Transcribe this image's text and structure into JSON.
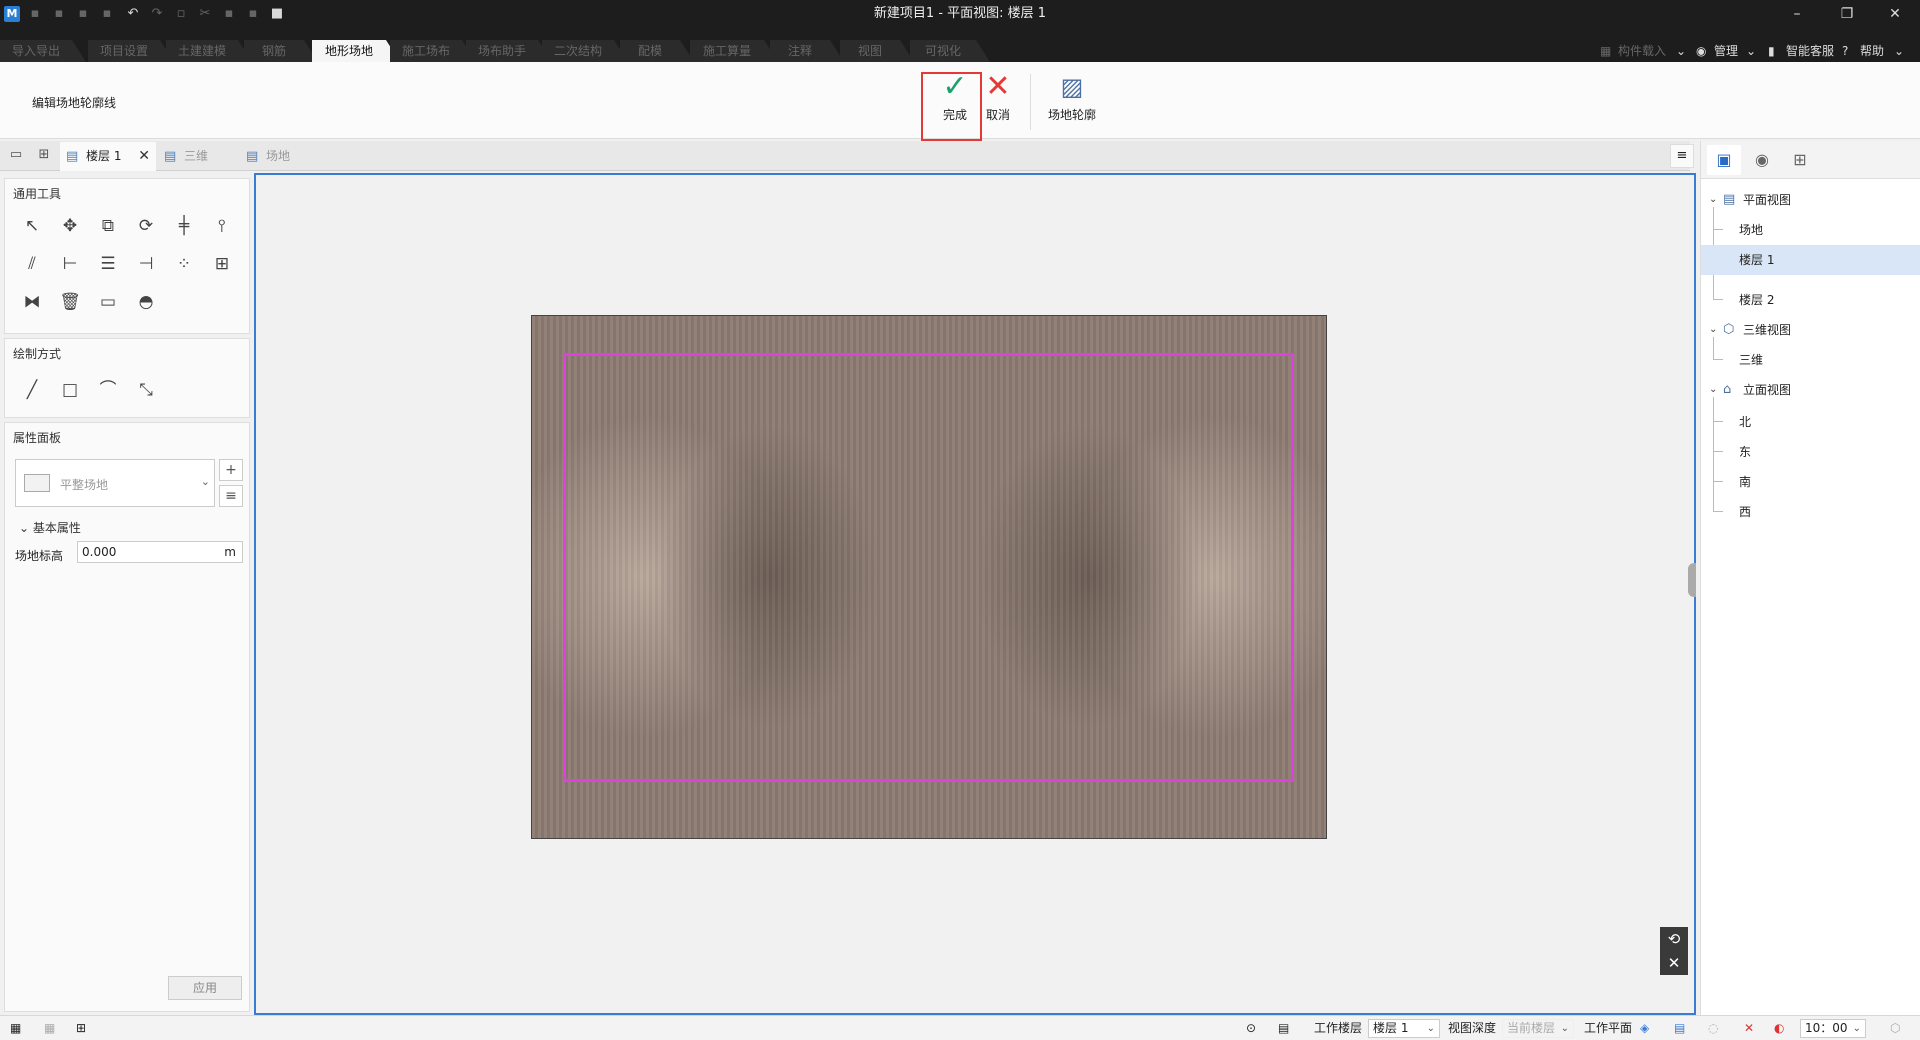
{
  "titlebar": {
    "title": "新建项目1 - 平面视图: 楼层 1",
    "app_icon": "M"
  },
  "ribbon_tabs": [
    "导入导出",
    "项目设置",
    "土建建模",
    "钢筋",
    "地形场地",
    "施工场布",
    "场布助手",
    "二次结构",
    "配模",
    "施工算量",
    "注释",
    "视图",
    "可视化"
  ],
  "active_tab": "地形场地",
  "topbar_right": {
    "component_load": "构件载入",
    "manage": "管理",
    "service": "智能客服",
    "help": "帮助"
  },
  "ribbon": {
    "mode_label": "编辑场地轮廓线",
    "finish": "完成",
    "cancel": "取消",
    "site_outline": "场地轮廓",
    "accent_green": "#1aa36b",
    "accent_red": "#e53935"
  },
  "view_tabs": {
    "floor1": "楼层 1",
    "three_d": "三维",
    "site": "场地"
  },
  "left_panel": {
    "general_tools": "通用工具",
    "draw_mode": "绘制方式",
    "props_panel": "属性面板",
    "type_placeholder": "平整场地",
    "basic_props": "基本属性",
    "site_elevation_label": "场地标高",
    "site_elevation_value": "0.000",
    "unit": "m",
    "apply": "应用"
  },
  "tree": {
    "plan_views": "平面视图",
    "site": "场地",
    "floor1": "楼层 1",
    "floor2": "楼层 2",
    "three_d_views": "三维视图",
    "three_d": "三维",
    "elevation_views": "立面视图",
    "north": "北",
    "east": "东",
    "south": "南",
    "west": "西"
  },
  "statusbar": {
    "work_floor_label": "工作楼层",
    "work_floor_value": "楼层 1",
    "view_depth_label": "视图深度",
    "view_depth_value": "当前楼层",
    "work_plane_label": "工作平面",
    "time_value": "10：00"
  },
  "colors": {
    "outline": "#e040e0",
    "canvas_border": "#3a7bd5",
    "site_fill": "#8b7a70"
  }
}
